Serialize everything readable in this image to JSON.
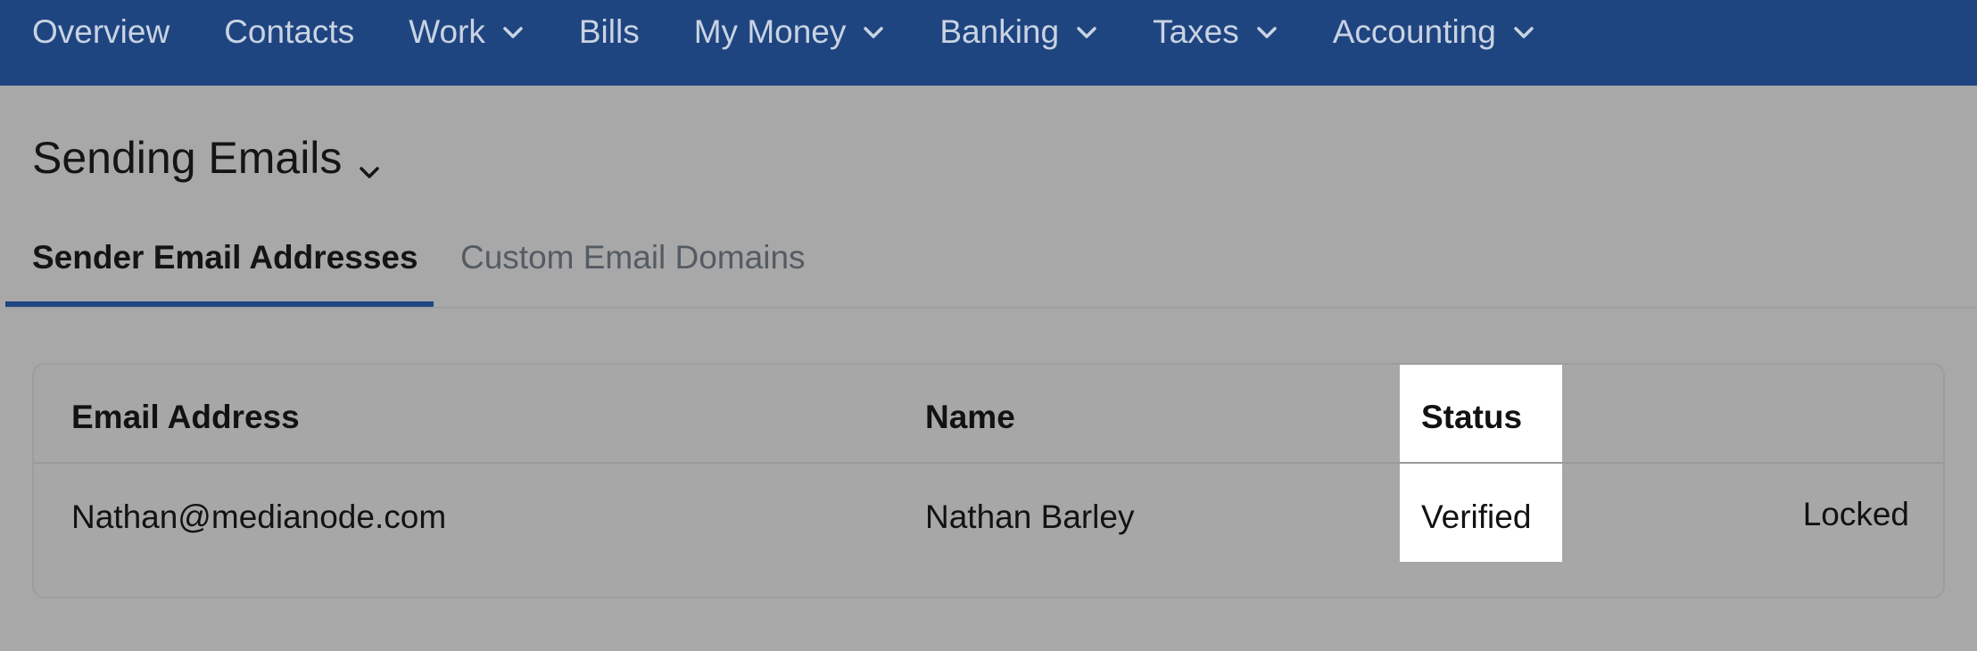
{
  "nav": {
    "items": [
      {
        "label": "Overview",
        "has_dropdown": false
      },
      {
        "label": "Contacts",
        "has_dropdown": false
      },
      {
        "label": "Work",
        "has_dropdown": true
      },
      {
        "label": "Bills",
        "has_dropdown": false
      },
      {
        "label": "My Money",
        "has_dropdown": true
      },
      {
        "label": "Banking",
        "has_dropdown": true
      },
      {
        "label": "Taxes",
        "has_dropdown": true
      },
      {
        "label": "Accounting",
        "has_dropdown": true
      }
    ]
  },
  "page": {
    "title": "Sending Emails"
  },
  "tabs": [
    {
      "label": "Sender Email Addresses",
      "active": true
    },
    {
      "label": "Custom Email Domains",
      "active": false
    }
  ],
  "table": {
    "headers": {
      "email": "Email Address",
      "name": "Name",
      "status": "Status"
    },
    "rows": [
      {
        "email": "Nathan@medianode.com",
        "name": "Nathan Barley",
        "status": "Verified",
        "action": "Locked"
      }
    ]
  },
  "colors": {
    "nav_bg": "#1f4580",
    "nav_text": "#c9d3e3",
    "accent": "#1f4580",
    "overlay_bg": "#a8a8a8",
    "highlight": "#ffffff"
  }
}
